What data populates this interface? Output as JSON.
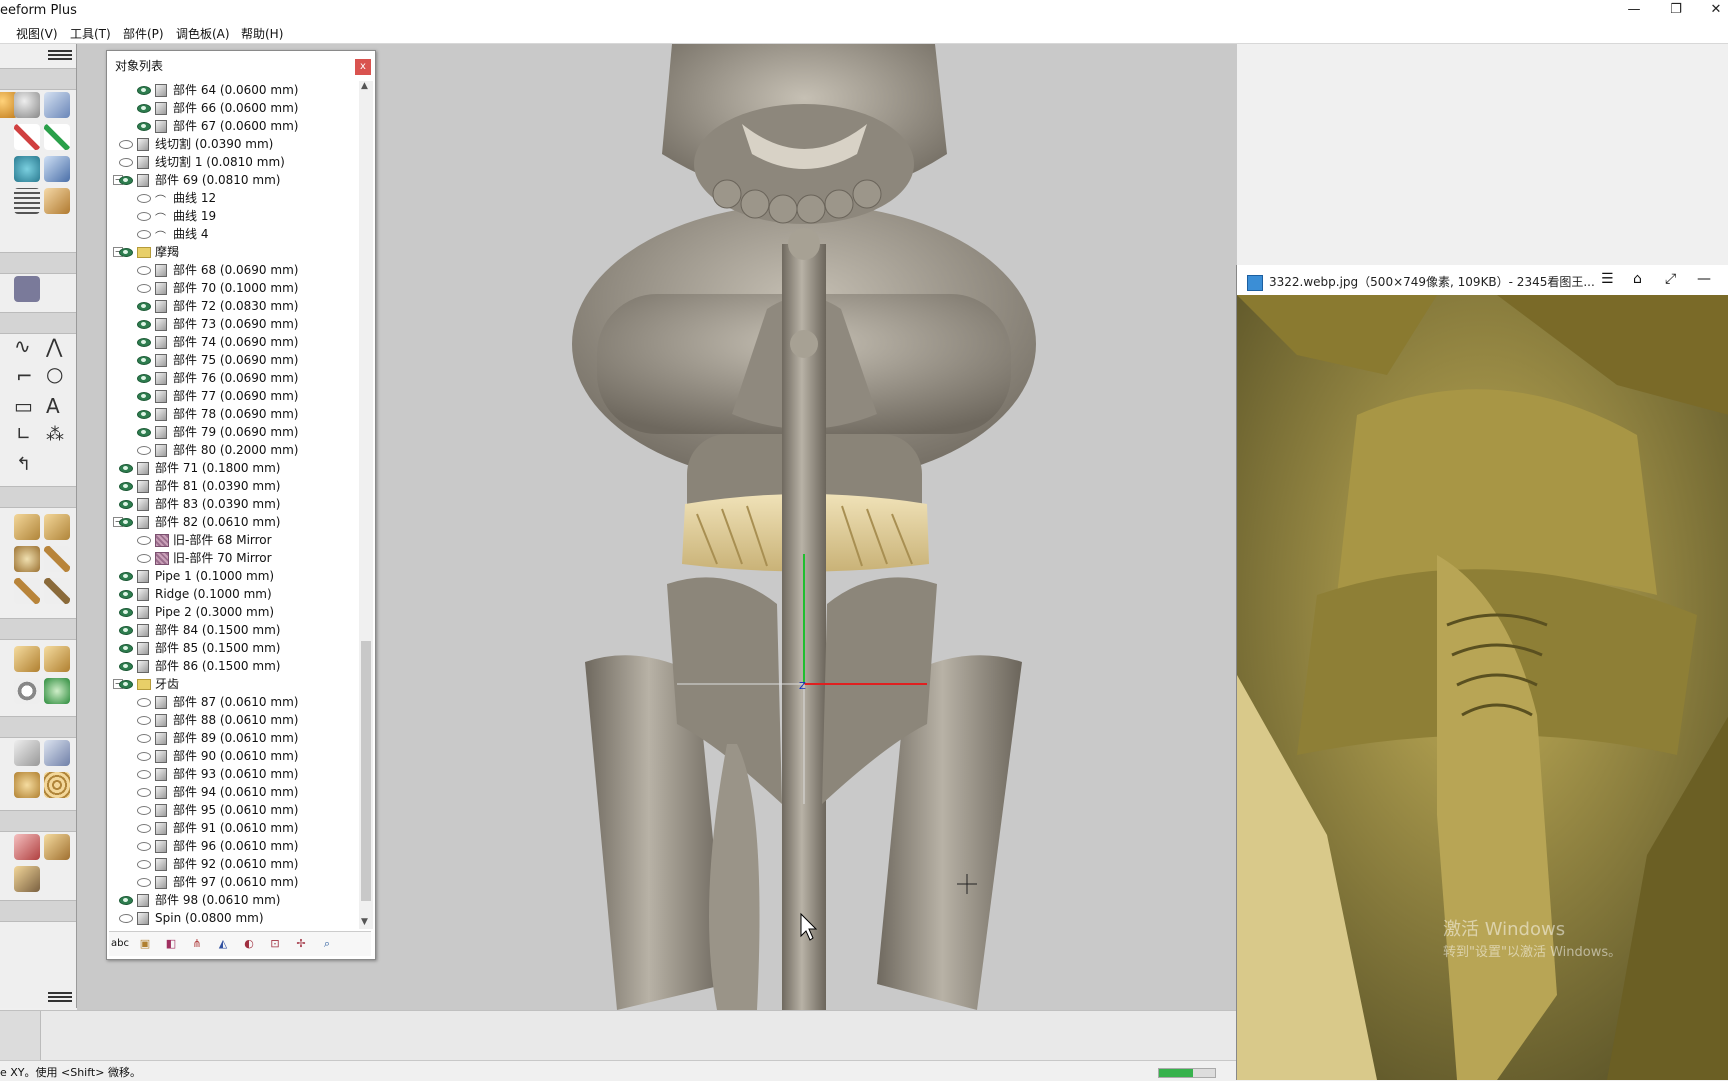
{
  "window": {
    "title": "eeform Plus"
  },
  "menu": [
    "视图(V)",
    "工具(T)",
    "部件(P)",
    "调色板(A)",
    "帮助(H)"
  ],
  "object_list": {
    "title": "对象列表",
    "close": "x",
    "rows": [
      {
        "label": "部件 64 (0.0600 mm)",
        "level": 2,
        "type": "part",
        "visible": true
      },
      {
        "label": "部件 66 (0.0600 mm)",
        "level": 2,
        "type": "part",
        "visible": true
      },
      {
        "label": "部件 67 (0.0600 mm)",
        "level": 2,
        "type": "part",
        "visible": true
      },
      {
        "label": "线切割 (0.0390 mm)",
        "level": 1,
        "type": "part",
        "visible": false
      },
      {
        "label": "线切割 1 (0.0810 mm)",
        "level": 1,
        "type": "part",
        "visible": false
      },
      {
        "label": "部件 69 (0.0810 mm)",
        "level": 1,
        "type": "part",
        "visible": true,
        "expander": "−"
      },
      {
        "label": "曲线 12",
        "level": 2,
        "type": "curve",
        "visible": false
      },
      {
        "label": "曲线 19",
        "level": 2,
        "type": "curve",
        "visible": false
      },
      {
        "label": "曲线 4",
        "level": 2,
        "type": "curve",
        "visible": false
      },
      {
        "label": "摩羯",
        "level": 1,
        "type": "folder",
        "visible": true,
        "expander": "−"
      },
      {
        "label": "部件 68 (0.0690 mm)",
        "level": 2,
        "type": "part",
        "visible": false
      },
      {
        "label": "部件 70 (0.1000 mm)",
        "level": 2,
        "type": "part",
        "visible": false
      },
      {
        "label": "部件 72 (0.0830 mm)",
        "level": 2,
        "type": "part",
        "visible": true
      },
      {
        "label": "部件 73 (0.0690 mm)",
        "level": 2,
        "type": "part",
        "visible": true
      },
      {
        "label": "部件 74 (0.0690 mm)",
        "level": 2,
        "type": "part",
        "visible": true
      },
      {
        "label": "部件 75 (0.0690 mm)",
        "level": 2,
        "type": "part",
        "visible": true
      },
      {
        "label": "部件 76 (0.0690 mm)",
        "level": 2,
        "type": "part",
        "visible": true
      },
      {
        "label": "部件 77 (0.0690 mm)",
        "level": 2,
        "type": "part",
        "visible": true
      },
      {
        "label": "部件 78 (0.0690 mm)",
        "level": 2,
        "type": "part",
        "visible": true
      },
      {
        "label": "部件 79 (0.0690 mm)",
        "level": 2,
        "type": "part",
        "visible": true
      },
      {
        "label": "部件 80 (0.2000 mm)",
        "level": 2,
        "type": "part",
        "visible": false
      },
      {
        "label": "部件 71 (0.1800 mm)",
        "level": 1,
        "type": "part",
        "visible": true
      },
      {
        "label": "部件 81 (0.0390 mm)",
        "level": 1,
        "type": "part",
        "visible": true
      },
      {
        "label": "部件 83 (0.0390 mm)",
        "level": 1,
        "type": "part",
        "visible": true
      },
      {
        "label": "部件 82 (0.0610 mm)",
        "level": 1,
        "type": "part",
        "visible": true,
        "expander": "−"
      },
      {
        "label": "旧-部件 68 Mirror",
        "level": 2,
        "type": "mirror",
        "visible": false
      },
      {
        "label": "旧-部件 70 Mirror",
        "level": 2,
        "type": "mirror",
        "visible": false
      },
      {
        "label": "Pipe 1 (0.1000 mm)",
        "level": 1,
        "type": "part",
        "visible": true
      },
      {
        "label": "Ridge (0.1000 mm)",
        "level": 1,
        "type": "part",
        "visible": true
      },
      {
        "label": "Pipe 2 (0.3000 mm)",
        "level": 1,
        "type": "part",
        "visible": true
      },
      {
        "label": "部件 84 (0.1500 mm)",
        "level": 1,
        "type": "part",
        "visible": true
      },
      {
        "label": "部件 85 (0.1500 mm)",
        "level": 1,
        "type": "part",
        "visible": true
      },
      {
        "label": "部件 86 (0.1500 mm)",
        "level": 1,
        "type": "part",
        "visible": true
      },
      {
        "label": "牙齿",
        "level": 1,
        "type": "folder",
        "visible": true,
        "expander": "−"
      },
      {
        "label": "部件 87 (0.0610 mm)",
        "level": 2,
        "type": "part",
        "visible": false
      },
      {
        "label": "部件 88 (0.0610 mm)",
        "level": 2,
        "type": "part",
        "visible": false
      },
      {
        "label": "部件 89 (0.0610 mm)",
        "level": 2,
        "type": "part",
        "visible": false
      },
      {
        "label": "部件 90 (0.0610 mm)",
        "level": 2,
        "type": "part",
        "visible": false
      },
      {
        "label": "部件 93 (0.0610 mm)",
        "level": 2,
        "type": "part",
        "visible": false
      },
      {
        "label": "部件 94 (0.0610 mm)",
        "level": 2,
        "type": "part",
        "visible": false
      },
      {
        "label": "部件 95 (0.0610 mm)",
        "level": 2,
        "type": "part",
        "visible": false
      },
      {
        "label": "部件 91 (0.0610 mm)",
        "level": 2,
        "type": "part",
        "visible": false
      },
      {
        "label": "部件 96 (0.0610 mm)",
        "level": 2,
        "type": "part",
        "visible": false
      },
      {
        "label": "部件 92 (0.0610 mm)",
        "level": 2,
        "type": "part",
        "visible": false
      },
      {
        "label": "部件 97 (0.0610 mm)",
        "level": 2,
        "type": "part",
        "visible": false
      },
      {
        "label": "部件 98 (0.0610 mm)",
        "level": 1,
        "type": "part",
        "visible": true
      },
      {
        "label": "Spin (0.0800 mm)",
        "level": 1,
        "type": "part",
        "visible": false
      }
    ],
    "bottom_label": "abc"
  },
  "viewer": {
    "title": "3322.webp.jpg（500×749像素, 109KB）- 2345看图王...",
    "watermark_line1": "激活 Windows",
    "watermark_line2": "转到\"设置\"以激活 Windows。"
  },
  "status": {
    "text": "e XY。使用 <Shift> 微移。",
    "progress": 0.6
  },
  "colors": {
    "viewport_bg": "#c9c9c9",
    "sculpt": "#9d968a",
    "belt": "#e2cf9a",
    "eye_on": "#2e7d4f"
  }
}
